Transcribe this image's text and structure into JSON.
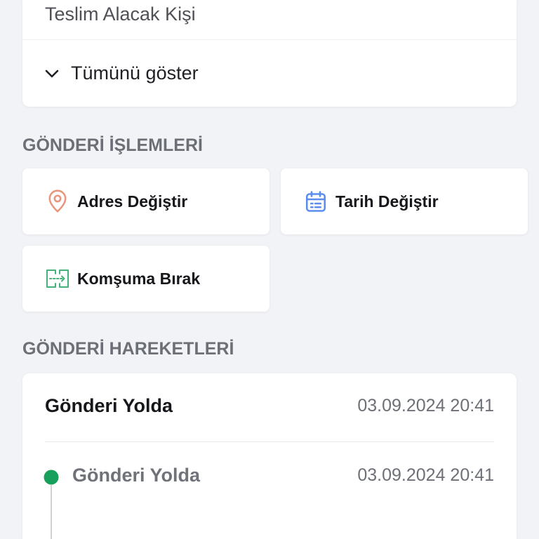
{
  "recipient_card": {
    "label": "Teslim Alacak Kişi",
    "toggle_label": "Tümünü göster",
    "toggle_icon": "chevron-down-icon"
  },
  "actions_section": {
    "title": "GÖNDERİ İŞLEMLERİ",
    "items": [
      {
        "label": "Adres Değiştir",
        "icon": "location-pin-icon",
        "color": "#e9967c"
      },
      {
        "label": "Tarih Değiştir",
        "icon": "calendar-icon",
        "color": "#5a8ded"
      },
      {
        "label": "Komşuma Bırak",
        "icon": "neighbor-handover-icon",
        "color": "#45b07a"
      }
    ]
  },
  "movements_section": {
    "title": "GÖNDERİ HAREKETLERİ",
    "current_status": {
      "label": "Gönderi Yolda",
      "datetime": "03.09.2024 20:41"
    },
    "events": [
      {
        "label": "Gönderi Yolda",
        "datetime": "03.09.2024 20:41",
        "dot_color": "#17a05b"
      }
    ]
  }
}
